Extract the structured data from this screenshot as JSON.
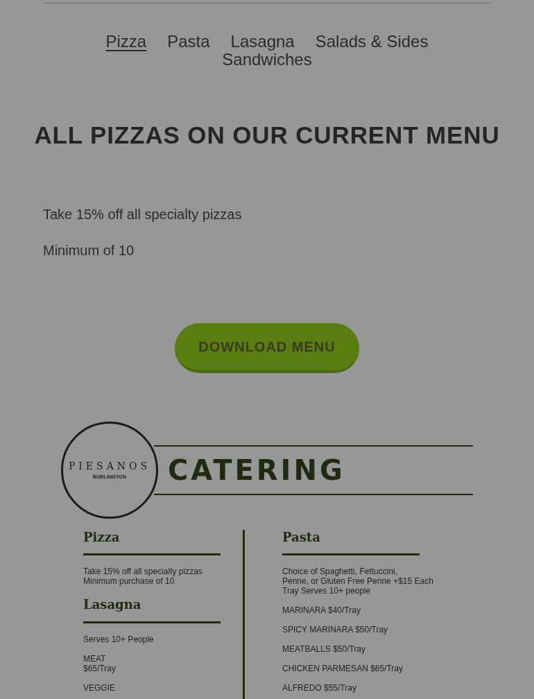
{
  "tabs": [
    {
      "label": "Pizza",
      "selected": true
    },
    {
      "label": "Pasta",
      "selected": false
    },
    {
      "label": "Lasagna",
      "selected": false
    },
    {
      "label": "Salads & Sides",
      "selected": false
    },
    {
      "label": "Sandwiches",
      "selected": false
    }
  ],
  "heading": "ALL PIZZAS ON OUR CURRENT MENU",
  "paragraphs": [
    "Take 15% off all specialty pizzas",
    "Minimum of 10"
  ],
  "download_button": "DOWNLOAD MENU",
  "catering": {
    "logo_name": "PIESANOS",
    "logo_sub": "BURLINGTON",
    "title": "CATERING",
    "left": [
      {
        "heading": "Pizza",
        "lines": [
          "Take 15% off all specialty pizzas\nMinimum purchase of 10"
        ]
      },
      {
        "heading": "Lasagna",
        "lines": [
          "Serves 10+ People",
          "MEAT\n$65/Tray",
          "VEGGIE"
        ]
      }
    ],
    "right": [
      {
        "heading": "Pasta",
        "lines": [
          "Choice of Spaghetti, Fettuccini,\nPenne, or Gluten Free Penne +$15 Each\nTray Serves 10+ people",
          "MARINARA $40/Tray",
          "SPICY MARINARA $50/Tray",
          "MEATBALLS $50/Tray",
          "CHICKEN PARMESAN $65/Tray",
          "ALFREDO $55/Tray"
        ]
      }
    ]
  }
}
